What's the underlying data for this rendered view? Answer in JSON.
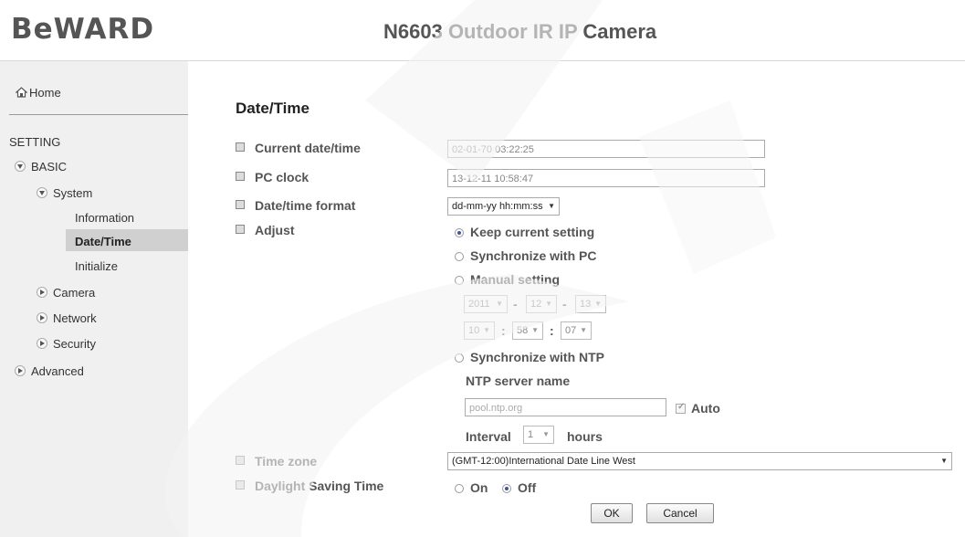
{
  "header": {
    "logo_text": "BeWARD",
    "camera_title": "N6603 Outdoor IR IP Camera"
  },
  "sidebar": {
    "home": "Home",
    "setting_heading": "SETTING",
    "basic": "BASIC",
    "system": "System",
    "information": "Information",
    "date_time": "Date/Time",
    "initialize": "Initialize",
    "camera": "Camera",
    "network": "Network",
    "security": "Security",
    "advanced": "Advanced",
    "active_item": "Date/Time"
  },
  "page": {
    "title": "Date/Time",
    "current_datetime_label": "Current date/time",
    "current_datetime_value": "02-01-70   03:22:25",
    "pc_clock_label": "PC clock",
    "pc_clock_value": "13-12-11   10:58:47",
    "format_label": "Date/time format",
    "format_value": "dd-mm-yy hh:mm:ss",
    "adjust_label": "Adjust",
    "adjust_options": {
      "keep": "Keep current setting",
      "sync_pc": "Synchronize with PC",
      "manual": "Manual setting",
      "sync_ntp": "Synchronize with NTP"
    },
    "adjust_selected": "keep",
    "manual": {
      "year": "2011",
      "month": "12",
      "day": "13",
      "hour": "10",
      "minute": "58",
      "second": "07",
      "date_sep": "-",
      "time_sep": ":"
    },
    "ntp": {
      "server_label": "NTP server name",
      "server_value": "pool.ntp.org",
      "auto_label": "Auto",
      "auto_checked": true,
      "interval_label": "Interval",
      "interval_value": "1",
      "interval_unit": "hours"
    },
    "timezone_label": "Time zone",
    "timezone_value": "(GMT-12:00)International Date Line West",
    "dst_label": "Daylight Saving Time",
    "dst_on": "On",
    "dst_off": "Off",
    "dst_selected": "off",
    "ok_label": "OK",
    "cancel_label": "Cancel"
  },
  "colors": {
    "sidebar_bg": "#f0f0f0",
    "active_bg": "#d0d0d0",
    "radio_dot": "#3b5998",
    "label_text": "#555555"
  }
}
